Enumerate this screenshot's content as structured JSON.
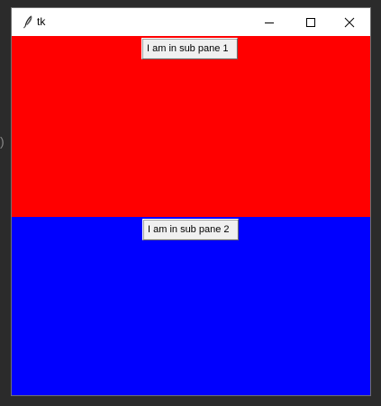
{
  "window": {
    "title": "tk"
  },
  "pane_one": {
    "color": "#ff0000",
    "button_label": "I am in sub pane 1"
  },
  "pane_two": {
    "color": "#0000ff",
    "button_label": "I am in sub pane 2"
  },
  "icons": {
    "app": "tk-feather-icon",
    "minimize": "minimize-icon",
    "maximize": "maximize-icon",
    "close": "close-icon"
  }
}
